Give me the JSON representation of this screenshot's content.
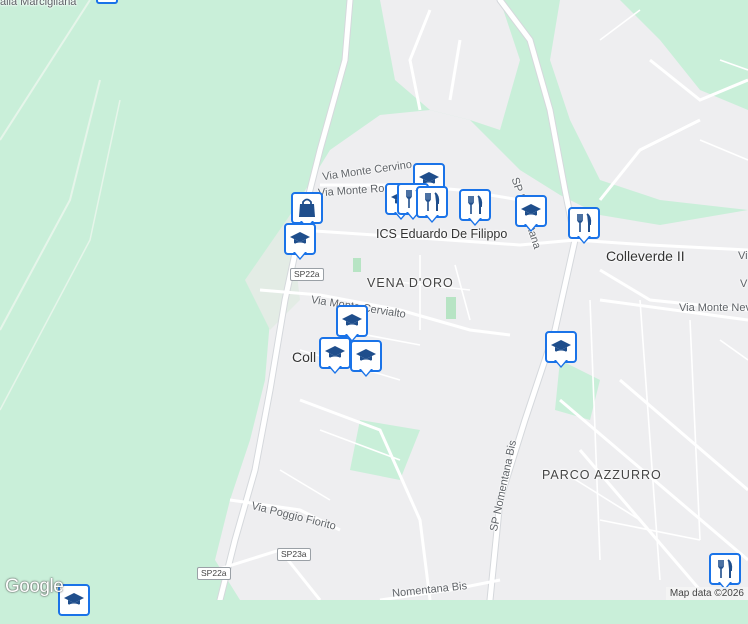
{
  "map": {
    "labels": {
      "top_left": "alla Marcigliana",
      "via_monte_cervino": "Via Monte Cervino",
      "via_monte_ro": "Via Monte Ro",
      "vena_doro": "VENA D'ORO",
      "via_monte_cervialto": "Via Monte Cervialto",
      "coll": "Coll",
      "colleverde": "Colleverde II",
      "colleverde_cut": "Vi",
      "via_monte_nev": "Via Monte Nev",
      "via_monte_nev_cut": "V",
      "parco_azzurro": "PARCO AZZURRO",
      "via_poggio_fiorito": "Via Poggio Fiorito",
      "sp_nomentana": "SP Nomentana",
      "sp_nomentana_bis": "SP Nomentana Bis",
      "nomentana_bis_bottom": "Nomentana Bis",
      "ics": "ICS Eduardo De Filippo"
    },
    "shields": {
      "sp22a_top": "SP22a",
      "sp23a": "SP23a",
      "sp22a_bottom": "SP22a"
    },
    "markers": [
      {
        "type": "school-icon"
      },
      {
        "type": "shopping-bag-icon"
      },
      {
        "type": "school-icon"
      },
      {
        "type": "school-icon"
      },
      {
        "type": "restaurant-icon"
      },
      {
        "type": "restaurant-icon"
      },
      {
        "type": "restaurant-icon"
      },
      {
        "type": "school-icon"
      },
      {
        "type": "restaurant-icon"
      },
      {
        "type": "school-icon"
      },
      {
        "type": "school-icon"
      },
      {
        "type": "school-icon"
      },
      {
        "type": "school-icon"
      },
      {
        "type": "restaurant-icon"
      },
      {
        "type": "school-icon"
      }
    ],
    "colors": {
      "green": "#c9efd9",
      "urban": "#eeeef0",
      "road": "#ffffff",
      "major_road": "#ffffff",
      "marker_border": "#1a73e8",
      "marker_icon": "#1f4e8c"
    }
  },
  "footer": {
    "logo": "Google",
    "attribution": "Map data ©2026"
  }
}
